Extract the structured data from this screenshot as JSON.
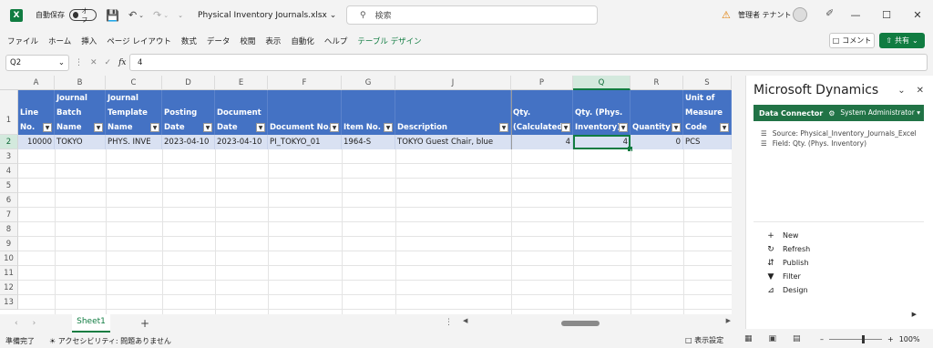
{
  "titlebar": {
    "logo": "X",
    "autosave_label": "自動保存",
    "autosave_state": "オフ",
    "filename": "Physical Inventory Journals.xlsx",
    "search_placeholder": "検索",
    "user": "管理者 テナント"
  },
  "ribbon": {
    "tabs": [
      "ファイル",
      "ホーム",
      "挿入",
      "ページ レイアウト",
      "数式",
      "データ",
      "校閲",
      "表示",
      "自動化",
      "ヘルプ",
      "テーブル デザイン"
    ],
    "comment_label": "コメント",
    "share_label": "共有"
  },
  "formula": {
    "namebox": "Q2",
    "fx": "fx",
    "value": "4"
  },
  "grid": {
    "columns": [
      "A",
      "B",
      "C",
      "D",
      "E",
      "F",
      "G",
      "J",
      "P",
      "Q",
      "R",
      "S"
    ],
    "selected_column": "Q",
    "row_numbers": [
      "1",
      "2",
      "3",
      "4",
      "5",
      "6",
      "7",
      "8",
      "9",
      "10",
      "11",
      "12",
      "13"
    ],
    "headers": [
      "Line\nNo.",
      "Journal\nBatch\nName",
      "Journal\nTemplate\nName",
      "Posting\nDate",
      "Document\nDate",
      "Document No.",
      "Item No.",
      "Description",
      "Qty.\n(Calculated",
      "Qty. (Phys.\nInventory)",
      "Quantity",
      "Unit of\nMeasure\nCode"
    ],
    "row": [
      "10000",
      "TOKYO",
      "PHYS. INVE",
      "2023-04-10",
      "2023-04-10",
      "PI_TOKYO_01",
      "1964-S",
      "TOKYO Guest Chair, blue",
      "4",
      "4",
      "0",
      "PCS"
    ],
    "header_color": "#4472c4",
    "row_color": "#d9e1f2"
  },
  "sheets": {
    "active": "Sheet1",
    "add": "+"
  },
  "statusbar": {
    "ready": "準備完了",
    "accessibility": "アクセシビリティ: 問題ありません",
    "display_settings": "表示設定",
    "zoom": "100%"
  },
  "pane": {
    "title": "Microsoft Dynamics",
    "connector": "Data Connector",
    "user": "System Administrator",
    "source": "Source: Physical_Inventory_Journals_Excel",
    "field": "Field: Qty. (Phys. Inventory)",
    "actions": [
      "New",
      "Refresh",
      "Publish",
      "Filter",
      "Design"
    ],
    "accent": "#217346"
  }
}
